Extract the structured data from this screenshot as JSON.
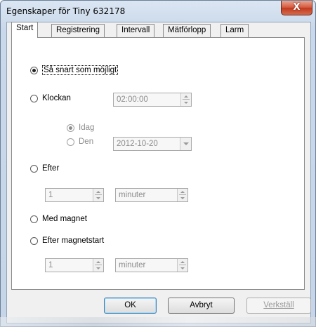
{
  "window": {
    "title": "Egenskaper för Tiny 632178",
    "close_label": "X"
  },
  "tabs": [
    {
      "label": "Start",
      "active": true
    },
    {
      "label": "Registrering",
      "active": false
    },
    {
      "label": "Intervall",
      "active": false
    },
    {
      "label": "Mätförlopp",
      "active": false
    },
    {
      "label": "Larm",
      "active": false
    }
  ],
  "start": {
    "asap_label": "Så snart som möjligt",
    "clock_label": "Klockan",
    "clock_time": "02:00:00",
    "today_label": "Idag",
    "date_label": "Den",
    "date_value": "2012-10-20",
    "after_label": "Efter",
    "after_count": "1",
    "after_unit": "minuter",
    "magnet_label": "Med magnet",
    "after_magnet_label": "Efter magnetstart",
    "after_magnet_count": "1",
    "after_magnet_unit": "minuter"
  },
  "buttons": {
    "ok": "OK",
    "cancel": "Avbryt",
    "apply": "Verkställ"
  }
}
